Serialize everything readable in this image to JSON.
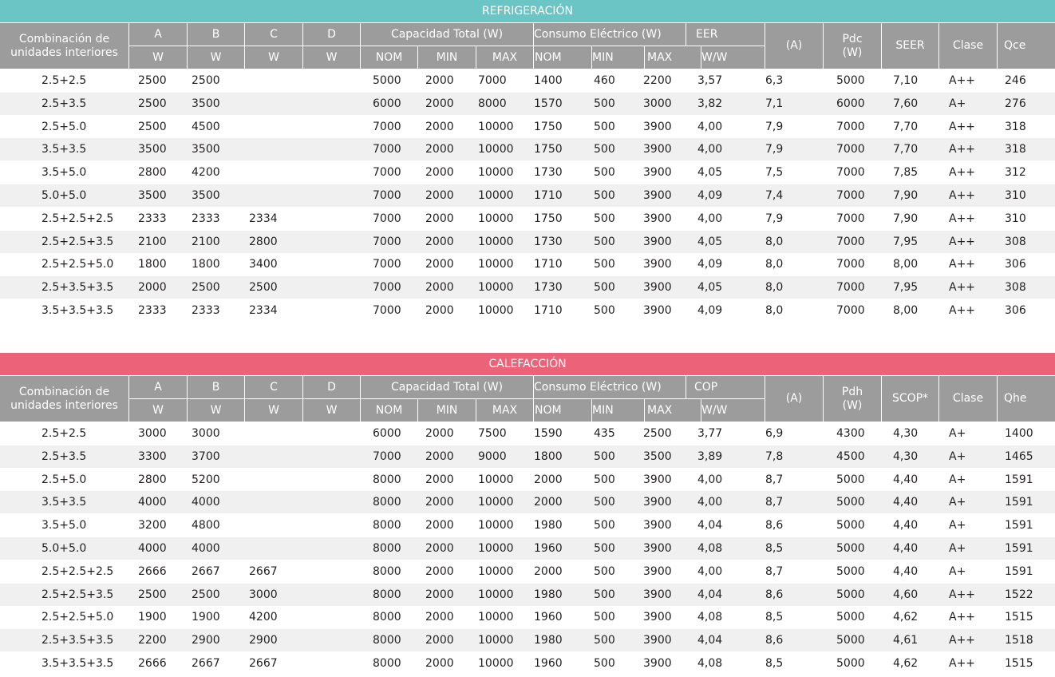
{
  "colors": {
    "refrigeracion_banner": "#6cc5c5",
    "calefaccion_banner": "#ec6278",
    "header_bg": "#9c9c9c",
    "row_alt": "#f0f0f0"
  },
  "header": {
    "combinacion": "Combinación de unidades interiores",
    "a": "A",
    "b": "B",
    "c": "C",
    "d": "D",
    "w": "W",
    "capacidad": "Capacidad Total (W)",
    "consumo": "Consumo Eléctrico (W)",
    "nom": "NOM",
    "min": "MIN",
    "max": "MAX",
    "ww": "W/W",
    "amp": "(A)",
    "clase": "Clase"
  },
  "refrigeracion": {
    "title": "REFRIGERACIÓN",
    "ratio": "EER",
    "pd": "Pdc (W)",
    "seasonal": "SEER",
    "q": "Qce",
    "rows": [
      [
        "2.5+2.5",
        "2500",
        "2500",
        "",
        "",
        "5000",
        "2000",
        "7000",
        "1400",
        "460",
        "2200",
        "3,57",
        "6,3",
        "5000",
        "7,10",
        "A++",
        "246"
      ],
      [
        "2.5+3.5",
        "2500",
        "3500",
        "",
        "",
        "6000",
        "2000",
        "8000",
        "1570",
        "500",
        "3000",
        "3,82",
        "7,1",
        "6000",
        "7,60",
        "A+",
        "276"
      ],
      [
        "2.5+5.0",
        "2500",
        "4500",
        "",
        "",
        "7000",
        "2000",
        "10000",
        "1750",
        "500",
        "3900",
        "4,00",
        "7,9",
        "7000",
        "7,70",
        "A++",
        "318"
      ],
      [
        "3.5+3.5",
        "3500",
        "3500",
        "",
        "",
        "7000",
        "2000",
        "10000",
        "1750",
        "500",
        "3900",
        "4,00",
        "7,9",
        "7000",
        "7,70",
        "A++",
        "318"
      ],
      [
        "3.5+5.0",
        "2800",
        "4200",
        "",
        "",
        "7000",
        "2000",
        "10000",
        "1730",
        "500",
        "3900",
        "4,05",
        "7,5",
        "7000",
        "7,85",
        "A++",
        "312"
      ],
      [
        "5.0+5.0",
        "3500",
        "3500",
        "",
        "",
        "7000",
        "2000",
        "10000",
        "1710",
        "500",
        "3900",
        "4,09",
        "7,4",
        "7000",
        "7,90",
        "A++",
        "310"
      ],
      [
        "2.5+2.5+2.5",
        "2333",
        "2333",
        "2334",
        "",
        "7000",
        "2000",
        "10000",
        "1750",
        "500",
        "3900",
        "4,00",
        "7,9",
        "7000",
        "7,90",
        "A++",
        "310"
      ],
      [
        "2.5+2.5+3.5",
        "2100",
        "2100",
        "2800",
        "",
        "7000",
        "2000",
        "10000",
        "1730",
        "500",
        "3900",
        "4,05",
        "8,0",
        "7000",
        "7,95",
        "A++",
        "308"
      ],
      [
        "2.5+2.5+5.0",
        "1800",
        "1800",
        "3400",
        "",
        "7000",
        "2000",
        "10000",
        "1710",
        "500",
        "3900",
        "4,09",
        "8,0",
        "7000",
        "8,00",
        "A++",
        "306"
      ],
      [
        "2.5+3.5+3.5",
        "2000",
        "2500",
        "2500",
        "",
        "7000",
        "2000",
        "10000",
        "1730",
        "500",
        "3900",
        "4,05",
        "8,0",
        "7000",
        "7,95",
        "A++",
        "308"
      ],
      [
        "3.5+3.5+3.5",
        "2333",
        "2333",
        "2334",
        "",
        "7000",
        "2000",
        "10000",
        "1710",
        "500",
        "3900",
        "4,09",
        "8,0",
        "7000",
        "8,00",
        "A++",
        "306"
      ]
    ]
  },
  "calefaccion": {
    "title": "CALEFACCIÓN",
    "ratio": "COP",
    "pd": "Pdh (W)",
    "seasonal": "SCOP*",
    "q": "Qhe",
    "rows": [
      [
        "2.5+2.5",
        "3000",
        "3000",
        "",
        "",
        "6000",
        "2000",
        "7500",
        "1590",
        "435",
        "2500",
        "3,77",
        "6,9",
        "4300",
        "4,30",
        "A+",
        "1400"
      ],
      [
        "2.5+3.5",
        "3300",
        "3700",
        "",
        "",
        "7000",
        "2000",
        "9000",
        "1800",
        "500",
        "3500",
        "3,89",
        "7,8",
        "4500",
        "4,30",
        "A+",
        "1465"
      ],
      [
        "2.5+5.0",
        "2800",
        "5200",
        "",
        "",
        "8000",
        "2000",
        "10000",
        "2000",
        "500",
        "3900",
        "4,00",
        "8,7",
        "5000",
        "4,40",
        "A+",
        "1591"
      ],
      [
        "3.5+3.5",
        "4000",
        "4000",
        "",
        "",
        "8000",
        "2000",
        "10000",
        "2000",
        "500",
        "3900",
        "4,00",
        "8,7",
        "5000",
        "4,40",
        "A+",
        "1591"
      ],
      [
        "3.5+5.0",
        "3200",
        "4800",
        "",
        "",
        "8000",
        "2000",
        "10000",
        "1980",
        "500",
        "3900",
        "4,04",
        "8,6",
        "5000",
        "4,40",
        "A+",
        "1591"
      ],
      [
        "5.0+5.0",
        "4000",
        "4000",
        "",
        "",
        "8000",
        "2000",
        "10000",
        "1960",
        "500",
        "3900",
        "4,08",
        "8,5",
        "5000",
        "4,40",
        "A+",
        "1591"
      ],
      [
        "2.5+2.5+2.5",
        "2666",
        "2667",
        "2667",
        "",
        "8000",
        "2000",
        "10000",
        "2000",
        "500",
        "3900",
        "4,00",
        "8,7",
        "5000",
        "4,40",
        "A+",
        "1591"
      ],
      [
        "2.5+2.5+3.5",
        "2500",
        "2500",
        "3000",
        "",
        "8000",
        "2000",
        "10000",
        "1980",
        "500",
        "3900",
        "4,04",
        "8,6",
        "5000",
        "4,60",
        "A++",
        "1522"
      ],
      [
        "2.5+2.5+5.0",
        "1900",
        "1900",
        "4200",
        "",
        "8000",
        "2000",
        "10000",
        "1960",
        "500",
        "3900",
        "4,08",
        "8,5",
        "5000",
        "4,62",
        "A++",
        "1515"
      ],
      [
        "2.5+3.5+3.5",
        "2200",
        "2900",
        "2900",
        "",
        "8000",
        "2000",
        "10000",
        "1980",
        "500",
        "3900",
        "4,04",
        "8,6",
        "5000",
        "4,61",
        "A++",
        "1518"
      ],
      [
        "3.5+3.5+3.5",
        "2666",
        "2667",
        "2667",
        "",
        "8000",
        "2000",
        "10000",
        "1960",
        "500",
        "3900",
        "4,08",
        "8,5",
        "5000",
        "4,62",
        "A++",
        "1515"
      ]
    ]
  }
}
